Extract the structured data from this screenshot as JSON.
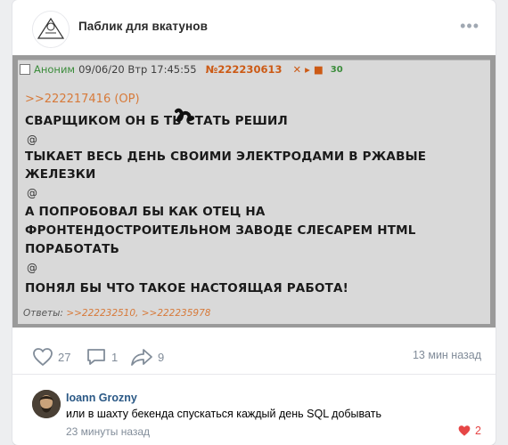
{
  "header": {
    "group_name": "Паблик для вкатунов",
    "more_label": "•••"
  },
  "board_post": {
    "author": "Аноним",
    "datetime": "09/06/20 Втр 17:45:55",
    "post_number": "№222230613",
    "controls": "✕ ▸ ■",
    "count": "30",
    "reply_link": ">>222217416 (OP)",
    "lines": [
      "СВАРЩИКОМ ОН Б  ТЬ СТАТЬ РЕШИЛ",
      "@",
      "ТЫКАЕТ ВЕСЬ ДЕНЬ СВОИМИ ЭЛЕКТРОДАМИ В РЖАВЫЕ",
      "ЖЕЛЕЗКИ",
      "@",
      "А ПОПРОБОВАЛ БЫ КАК ОТЕЦ НА",
      "ФРОНТЕНДОСТРОИТЕЛЬНОМ ЗАВОДЕ СЛЕСАРЕМ HTML",
      "ПОРАБОТАТЬ",
      "@",
      "ПОНЯЛ БЫ ЧТО ТАКОЕ НАСТОЯЩАЯ РАБОТА!"
    ],
    "answers_label": "Ответы:",
    "answers_links": ">>222232510, >>222235978"
  },
  "actions": {
    "likes": "27",
    "comments": "1",
    "shares": "9",
    "time": "13 мин назад"
  },
  "comment": {
    "author": "Ioann Grozny",
    "text": "или в шахту бекенда спускаться каждый день SQL добывать",
    "time": "23 минуты назад",
    "likes": "2"
  },
  "colors": {
    "link": "#2a5885",
    "muted": "#818c99",
    "like_active": "#e64646",
    "board_bg": "#d9d9d9",
    "board_accent": "#cc5a15"
  }
}
